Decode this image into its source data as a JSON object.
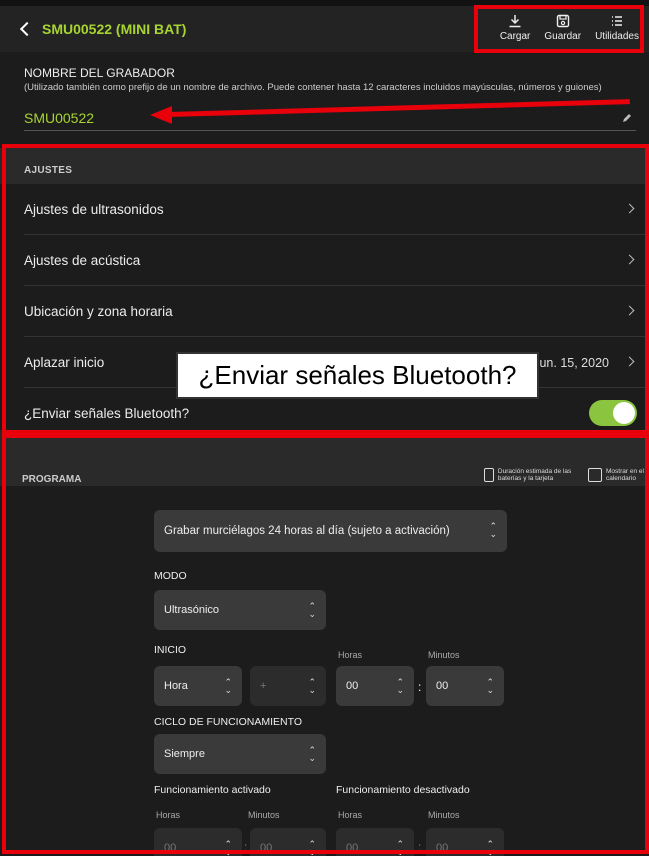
{
  "header": {
    "title": "SMU00522 (MINI BAT)",
    "tools": [
      {
        "label": "Cargar",
        "icon": "download-icon"
      },
      {
        "label": "Guardar",
        "icon": "save-icon"
      },
      {
        "label": "Utilidades",
        "icon": "list-icon"
      }
    ]
  },
  "recorder_name": {
    "label": "NOMBRE DEL GRABADOR",
    "help": "(Utilizado también como prefijo de un nombre de archivo. Puede contener hasta 12 caracteres incluidos mayúsculas, números y guiones)",
    "value": "SMU00522"
  },
  "ajustes": {
    "heading": "AJUSTES",
    "rows": [
      {
        "label": "Ajustes de ultrasonidos"
      },
      {
        "label": "Ajustes de acústica"
      },
      {
        "label": "Ubicación y zona horaria"
      },
      {
        "label": "Aplazar inicio",
        "value": "jun. 15, 2020"
      },
      {
        "label": "¿Enviar señales Bluetooth?",
        "toggle_on": true
      }
    ]
  },
  "callout": "¿Enviar señales Bluetooth?",
  "programa": {
    "heading": "PROGRAMA",
    "battery_link": "Duración estimada de las baterías y la tarjeta",
    "calendar_link": "Mostrar en el calendario",
    "schedule": "Grabar murciélagos 24 horas al día (sujeto a activación)",
    "modo_label": "MODO",
    "modo_value": "Ultrasónico",
    "inicio_label": "INICIO",
    "inicio_type": "Hora",
    "inicio_offset": "+",
    "horas_label": "Horas",
    "minutos_label": "Minutos",
    "inicio_horas": "00",
    "inicio_minutos": "00",
    "ciclo_label": "CICLO DE FUNCIONAMIENTO",
    "ciclo_value": "Siempre",
    "on_label": "Funcionamiento activado",
    "off_label": "Funcionamiento desactivado",
    "on_horas": "00",
    "on_minutos": "00",
    "off_horas": "00",
    "off_minutos": "00"
  },
  "colors": {
    "accent_green": "#a7d431",
    "toggle_green": "#8bc53f",
    "annotation_red": "#e8000b",
    "background": "#1c1c1c"
  }
}
